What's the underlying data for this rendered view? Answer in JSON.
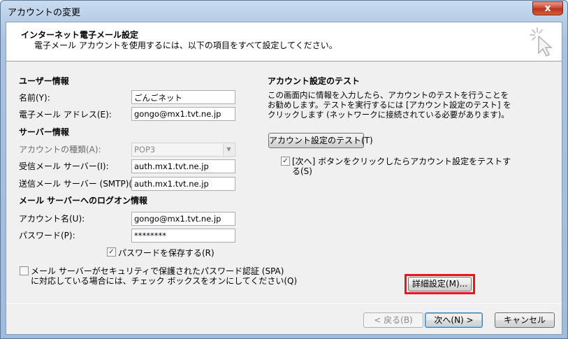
{
  "window": {
    "title": "アカウントの変更",
    "close_glyph": "x"
  },
  "header": {
    "title": "インターネット電子メール設定",
    "subtitle": "電子メール アカウントを使用するには、以下の項目をすべて設定してください。"
  },
  "user_info": {
    "section_title": "ユーザー情報",
    "name_label": "名前(Y):",
    "name_value": "ごんごネット",
    "email_label": "電子メール アドレス(E):",
    "email_value": "gongo@mx1.tvt.ne.jp"
  },
  "server_info": {
    "section_title": "サーバー情報",
    "account_type_label": "アカウントの種類(A):",
    "account_type_value": "POP3",
    "incoming_label": "受信メール サーバー(I):",
    "incoming_value": "auth.mx1.tvt.ne.jp",
    "outgoing_label": "送信メール サーバー (SMTP)(O):",
    "outgoing_value": "auth.mx1.tvt.ne.jp"
  },
  "logon_info": {
    "section_title": "メール サーバーへのログオン情報",
    "account_label": "アカウント名(U):",
    "account_value": "gongo@mx1.tvt.ne.jp",
    "password_label": "パスワード(P):",
    "password_value": "********",
    "save_password_label": "パスワードを保存する(R)",
    "save_password_checked": true,
    "spa_line1": "メール サーバーがセキュリティで保護されたパスワード認証 (SPA)",
    "spa_line2": "に対応している場合には、チェック ボックスをオンにしてください(Q)",
    "spa_checked": false
  },
  "test": {
    "section_title": "アカウント設定のテスト",
    "desc_line1": "この画面内に情報を入力したら、アカウントのテストを行うことを",
    "desc_line2": "お勧めします。テストを実行するには [アカウント設定のテスト] を",
    "desc_line3": "クリックします (ネットワークに接続されている必要があります)。",
    "test_button": "アカウント設定のテスト(T)",
    "auto_test_line1": "[次へ] ボタンをクリックしたらアカウント設定をテストす",
    "auto_test_line2": "る(S)",
    "auto_test_checked": true
  },
  "more_settings_button": "詳細設定(M)...",
  "footer": {
    "back_button": "< 戻る(B)",
    "next_button": "次へ(N) >",
    "cancel_button": "キャンセル"
  },
  "colors": {
    "highlight": "#e8141e",
    "accent": "#3c7fb1"
  }
}
